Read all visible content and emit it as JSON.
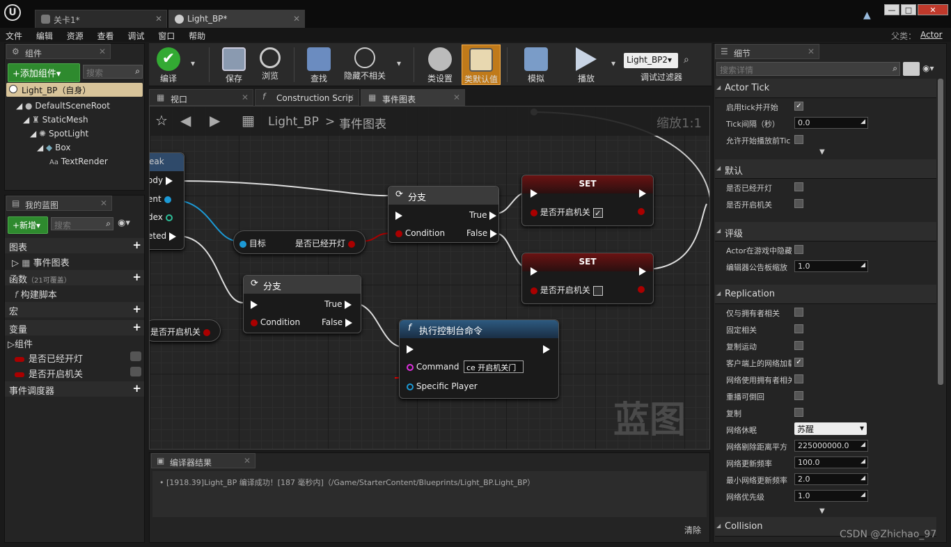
{
  "titlebar": {
    "tabs": [
      {
        "label": "关卡1*"
      },
      {
        "label": "Light_BP*"
      }
    ],
    "buttons": [
      "—",
      "□",
      "✕"
    ]
  },
  "menu": {
    "items": [
      "文件",
      "编辑",
      "资源",
      "查看",
      "调试",
      "窗口",
      "帮助"
    ],
    "parent_label": "父类：",
    "parent_value": "Actor"
  },
  "components_panel": {
    "title": "组件",
    "add_button": "+添加组件▾",
    "search_placeholder": "搜索",
    "self_item": "Light_BP（自身）",
    "tree": [
      "DefaultSceneRoot",
      "StaticMesh",
      "SpotLight",
      "Box",
      "TextRender"
    ]
  },
  "myblueprint_panel": {
    "title": "我的蓝图",
    "new_button": "+新增▾",
    "search_placeholder": "搜索",
    "sections": {
      "graphs": "图表",
      "event_graph": "事件图表",
      "functions": "函数",
      "functions_hint": "（21可覆盖）",
      "construction": "构建脚本",
      "macros": "宏",
      "variables": "变量",
      "components": "组件",
      "var1": "是否已经开灯",
      "var2": "是否开启机关",
      "dispatchers": "事件调度器"
    }
  },
  "toolbar": {
    "buttons": [
      "编译",
      "保存",
      "浏览",
      "查找",
      "隐藏不相关",
      "类设置",
      "类默认值",
      "模拟",
      "播放"
    ],
    "debug_filter_value": "Light_BP2▾",
    "debug_filter_label": "调试过滤器"
  },
  "editor_tabs": [
    {
      "label": "视口"
    },
    {
      "label": "Construction Scrip"
    },
    {
      "label": "事件图表"
    }
  ],
  "graph": {
    "breadcrumb_root": "Light_BP",
    "breadcrumb_sep": ">",
    "breadcrumb_page": "事件图表",
    "zoom": "缩放1:1",
    "watermark": "蓝图",
    "left_node_title": "eak",
    "left_node_pins": [
      "ody",
      "ent",
      "dex",
      "eted"
    ],
    "get_target_node": {
      "target": "目标",
      "output": "是否已经开灯"
    },
    "get_var_node": {
      "label": "是否开启机关"
    },
    "branch1": {
      "title": "分支",
      "condition": "Condition",
      "true": "True",
      "false": "False"
    },
    "branch2": {
      "title": "分支",
      "condition": "Condition",
      "true": "True",
      "false": "False"
    },
    "set1": {
      "title": "SET",
      "pin": "是否开启机关",
      "checked": "✓"
    },
    "set2": {
      "title": "SET",
      "pin": "是否开启机关"
    },
    "console": {
      "title": "执行控制台命令",
      "command_label": "Command",
      "command_value": "ce 开启机关门",
      "player_label": "Specific Player"
    }
  },
  "results": {
    "title": "编译器结果",
    "log": "[1918.39]Light_BP 编译成功！[187 毫秒内]（/Game/StarterContent/Blueprints/Light_BP.Light_BP）",
    "clear": "清除"
  },
  "details": {
    "title": "细节",
    "search_placeholder": "搜索详情",
    "sections": {
      "actor_tick": "Actor Tick",
      "default": "默认",
      "rendering": "评级",
      "replication": "Replication",
      "collision": "Collision"
    },
    "tick_rows": [
      {
        "label": "启用tick并开始",
        "type": "check",
        "value": "✓"
      },
      {
        "label": "Tick间隔（秒）",
        "type": "num",
        "value": "0.0"
      },
      {
        "label": "允许开始播放前Tic",
        "type": "check",
        "value": ""
      }
    ],
    "default_rows": [
      {
        "label": "是否已经开灯",
        "type": "check",
        "value": ""
      },
      {
        "label": "是否开启机关",
        "type": "check",
        "value": ""
      }
    ],
    "render_rows": [
      {
        "label": "Actor在游戏中隐藏",
        "type": "check",
        "value": ""
      },
      {
        "label": "编辑器公告板缩放",
        "type": "num",
        "value": "1.0"
      }
    ],
    "repl_rows": [
      {
        "label": "仅与拥有者相关",
        "type": "check",
        "value": ""
      },
      {
        "label": "固定相关",
        "type": "check",
        "value": ""
      },
      {
        "label": "复制运动",
        "type": "check",
        "value": ""
      },
      {
        "label": "客户端上的网络加载",
        "type": "check",
        "value": "✓"
      },
      {
        "label": "网络使用拥有者相关",
        "type": "check",
        "value": ""
      },
      {
        "label": "重播可倒回",
        "type": "check",
        "value": ""
      },
      {
        "label": "复制",
        "type": "check",
        "value": ""
      },
      {
        "label": "网络休眠",
        "type": "select",
        "value": "苏醒"
      },
      {
        "label": "网络剔除距离平方",
        "type": "num",
        "value": "225000000.0"
      },
      {
        "label": "网络更新频率",
        "type": "num",
        "value": "100.0"
      },
      {
        "label": "最小网络更新频率",
        "type": "num",
        "value": "2.0"
      },
      {
        "label": "网络优先级",
        "type": "num",
        "value": "1.0"
      }
    ]
  },
  "watermark_corner": "CSDN @Zhichao_97",
  "colors": {
    "accent_orange": "#c07a1a",
    "green_button": "#2e8a2e",
    "exec_red": "#b01010",
    "bool_pin": "#a00000"
  }
}
